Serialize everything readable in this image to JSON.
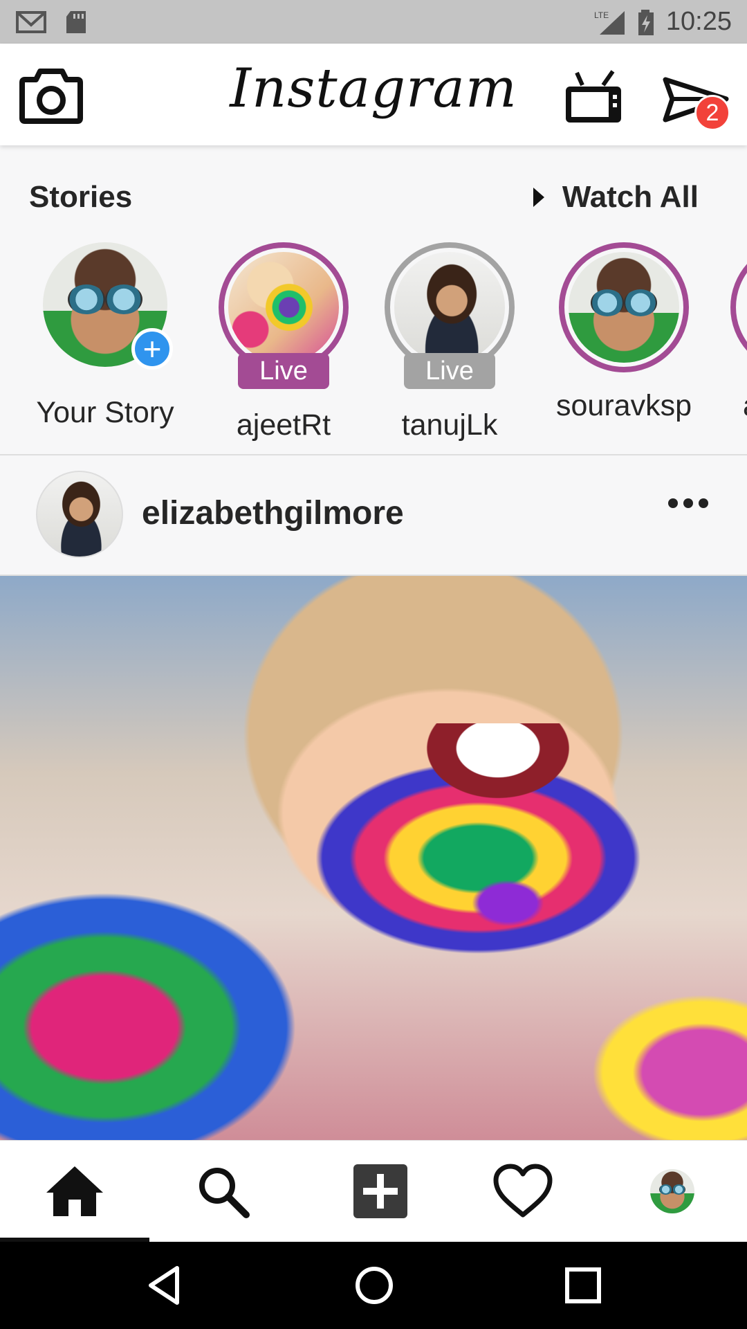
{
  "status_bar": {
    "time": "10:25",
    "network": "LTE",
    "icons": [
      "gmail-icon",
      "sd-card-icon",
      "signal-icon",
      "battery-charging-icon"
    ]
  },
  "top_bar": {
    "logo": "Instagram",
    "icons": [
      "camera-icon",
      "igtv-icon",
      "direct-message-icon"
    ],
    "dm_badge": "2"
  },
  "stories": {
    "title": "Stories",
    "watch_all": "Watch All",
    "items": [
      {
        "name": "Your Story",
        "live": false,
        "add_badge": "+"
      },
      {
        "name": "ajeetRt",
        "live": true,
        "live_label": "Live",
        "ring_color": "#a34b94"
      },
      {
        "name": "tanujLk",
        "live": true,
        "live_label": "Live",
        "ring_color": "#a3a3a3"
      },
      {
        "name": "souravksp",
        "live": false,
        "ring_color": "#a34b94"
      },
      {
        "name": "a",
        "live": false,
        "ring_color": "#a34b94"
      }
    ]
  },
  "post": {
    "username": "elizabethgilmore",
    "more_icon": "more-horizontal-icon"
  },
  "bottom_nav": {
    "items": [
      "home-icon",
      "search-icon",
      "add-post-icon",
      "heart-icon",
      "profile-avatar"
    ],
    "active": "home-icon"
  },
  "system_nav": {
    "items": [
      "back-icon",
      "home-circle-icon",
      "recents-icon"
    ]
  },
  "colors": {
    "story_ring": "#a34b94",
    "live_gray": "#a3a3a3",
    "badge_red": "#f2423a",
    "add_blue": "#2f94ee"
  }
}
